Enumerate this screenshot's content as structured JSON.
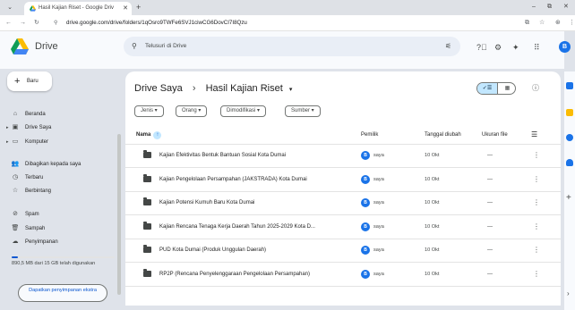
{
  "browser": {
    "tab_title": "Hasil Kajian Riset - Google Driv",
    "tab_close": "✕",
    "new_tab": "+",
    "url": "drive.google.com/drive/folders/1qOsro9TWFe6SVJ1ciwCG6DovCI7I8Qzu",
    "window_controls": [
      "–",
      "⧉",
      "✕"
    ]
  },
  "header": {
    "app_name": "Drive",
    "search_placeholder": "Telusuri di Drive",
    "avatar_letter": "B"
  },
  "sidebar": {
    "new_button": "Baru",
    "items": [
      {
        "label": "Beranda",
        "icon": "home-icon"
      },
      {
        "label": "Drive Saya",
        "icon": "my-drive-icon"
      },
      {
        "label": "Komputer",
        "icon": "computer-icon"
      },
      {
        "label": "Dibagikan kepada saya",
        "icon": "shared-icon"
      },
      {
        "label": "Terbaru",
        "icon": "clock-icon"
      },
      {
        "label": "Berbintang",
        "icon": "star-icon"
      },
      {
        "label": "Spam",
        "icon": "spam-icon"
      },
      {
        "label": "Sampah",
        "icon": "trash-icon"
      },
      {
        "label": "Penyimpanan",
        "icon": "cloud-icon"
      }
    ],
    "storage_text": "890,5 MB dari 15 GB telah digunakan",
    "storage_fraction": 0.058,
    "get_storage": "Dapatkan penyimpanan ekstra"
  },
  "main": {
    "breadcrumb_root": "Drive Saya",
    "breadcrumb_sep": "›",
    "breadcrumb_current": "Hasil Kajian Riset",
    "filters": [
      "Jenis",
      "Orang",
      "Dimodifikasi",
      "Sumber"
    ],
    "columns": {
      "name": "Nama",
      "owner": "Pemilik",
      "modified": "Tanggal diubah",
      "size": "Ukuran file"
    },
    "rows": [
      {
        "name": "Kajian Efektivitas Bentuk Bantuan Sosial Kota Dumai",
        "owner": "saya",
        "modified": "10 Okt",
        "size": "—"
      },
      {
        "name": "Kajian Pengelolaan Persampahan (JAKSTRADA) Kota Dumai",
        "owner": "saya",
        "modified": "10 Okt",
        "size": "—"
      },
      {
        "name": "Kajian Potensi Kumuh Baru Kota Dumai",
        "owner": "saya",
        "modified": "10 Okt",
        "size": "—"
      },
      {
        "name": "Kajian Rencana Tenaga Kerja Daerah Tahun 2025-2029 Kota D...",
        "owner": "saya",
        "modified": "10 Okt",
        "size": "—"
      },
      {
        "name": "PUD Kota Dumai (Produk Unggulan Daerah)",
        "owner": "saya",
        "modified": "10 Okt",
        "size": "—"
      },
      {
        "name": "RP2P (Rencana Penyelenggaraan Pengelolaan Persampahan)",
        "owner": "saya",
        "modified": "10 Okt",
        "size": "—"
      }
    ]
  },
  "colors": {
    "accent": "#0b57d0",
    "avatar": "#1a73e8",
    "selected": "#c2e7ff",
    "background": "#f8fafd"
  }
}
